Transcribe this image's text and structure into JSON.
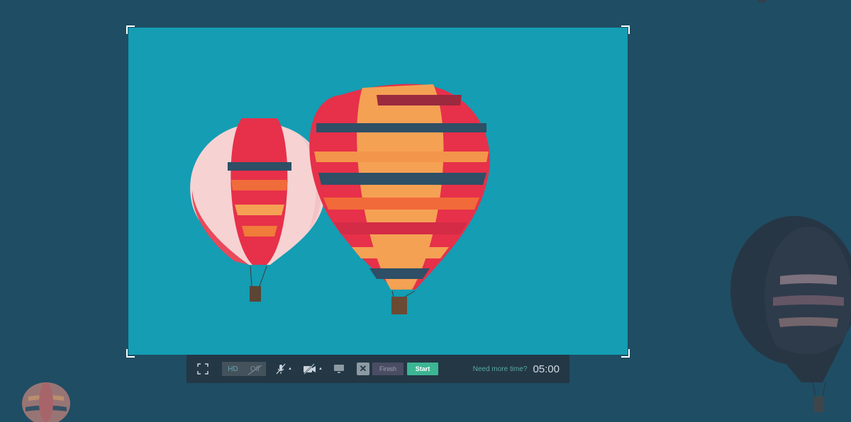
{
  "toolbar": {
    "quality": {
      "hd": "HD",
      "off": "Off"
    },
    "finish_label": "Finish",
    "start_label": "Start",
    "need_more_time": "Need more time?",
    "timer": "05:00",
    "icons": {
      "fullscreen": "fullscreen-icon",
      "mic": "mic-muted-icon",
      "camera": "camera-off-icon",
      "screen": "monitor-icon",
      "close": "close-icon"
    },
    "close_glyph": "✕"
  },
  "colors": {
    "background": "#1f4d63",
    "capture_sky": "#149db3",
    "toolbar": "#243745",
    "start": "#3cb592",
    "finish": "#4a4d63"
  }
}
